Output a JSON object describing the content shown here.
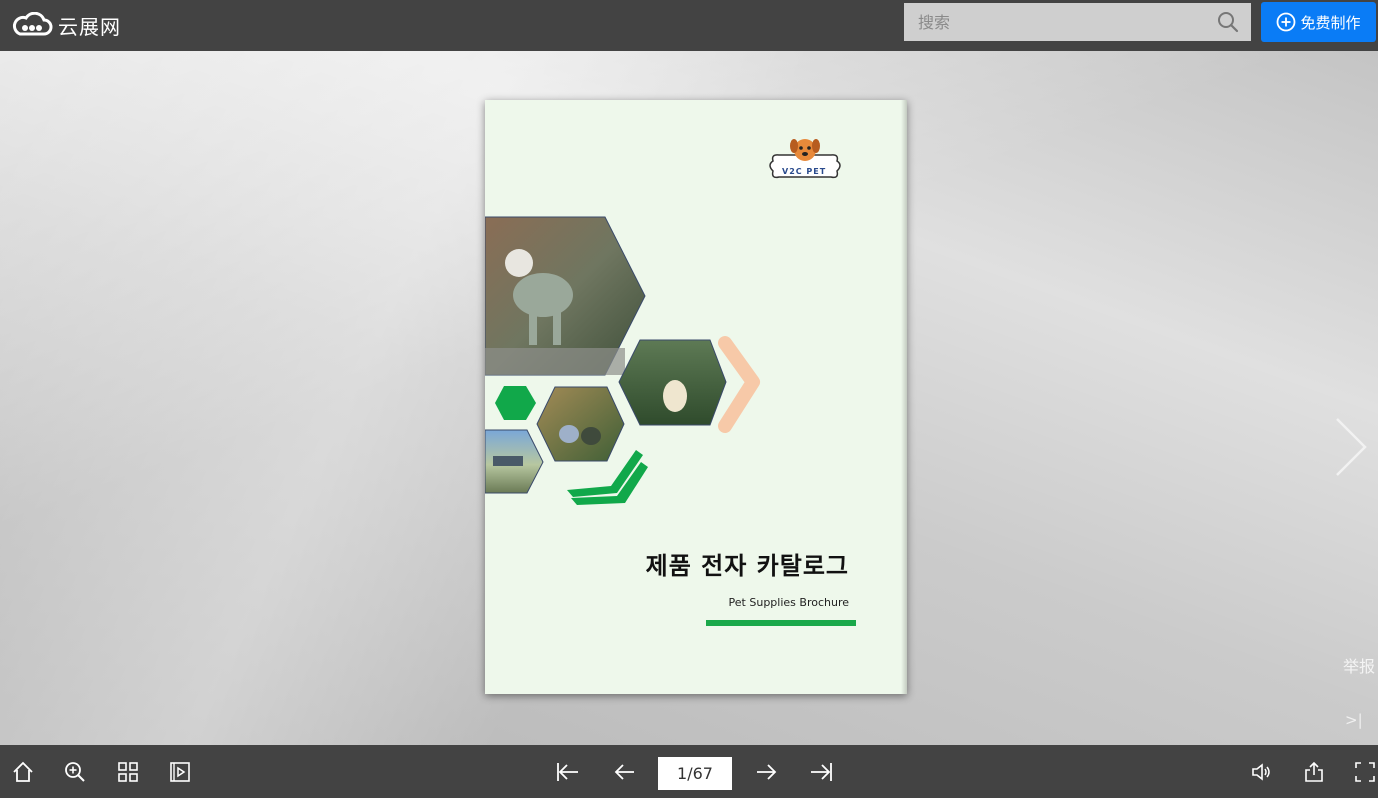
{
  "header": {
    "logo_text": "云展网",
    "search_placeholder": "搜索",
    "create_label": "免费制作"
  },
  "book": {
    "cover_title": "제품 전자 카탈로그",
    "cover_subtitle": "Pet Supplies Brochure",
    "brand_logo_text": "V2C PET",
    "page_indicator": "1/67"
  },
  "stage": {
    "report_label": "举报",
    "end_label": ">|"
  },
  "icons": {
    "home": "home-icon",
    "zoom": "zoom-in-icon",
    "thumbs": "thumbnails-icon",
    "autoplay": "autoplay-icon",
    "first": "first-page-icon",
    "prev": "prev-page-icon",
    "next": "next-page-icon",
    "last": "last-page-icon",
    "sound": "sound-icon",
    "share": "share-icon",
    "fullscreen": "fullscreen-icon"
  },
  "colors": {
    "toolbar": "#434343",
    "accent": "#0a7cf6",
    "cover_green": "#1aa84a",
    "cover_bg": "#eef8eb",
    "chevron_peach": "#f7c9a8"
  }
}
